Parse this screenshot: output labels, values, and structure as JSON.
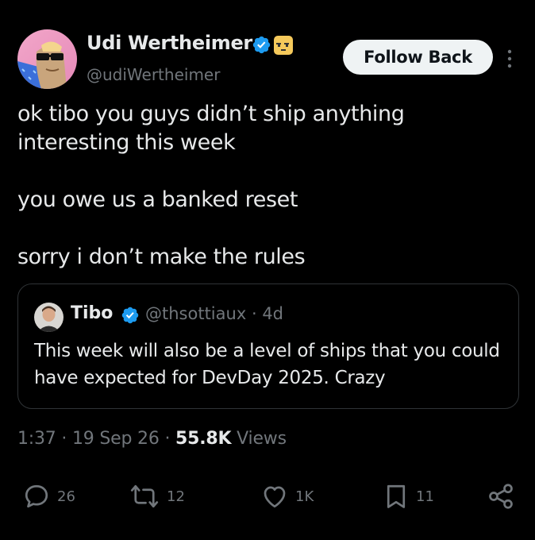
{
  "tweet": {
    "author": {
      "name": "Udi Wertheimer",
      "handle": "@udiWertheimer",
      "avatar_icon": "avatar-sunglasses-icon",
      "verified_icon": "verified-badge-icon",
      "affiliate_icon": "affiliate-badge-icon"
    },
    "follow_label": "Follow Back",
    "more_icon": "more-vertical-icon",
    "text": [
      "ok tibo you guys didn’t ship anything\ninteresting this week",
      "you owe us a banked reset",
      "sorry i don’t make the rules"
    ],
    "quote": {
      "name": "Tibo",
      "handle": "@thsottiaux",
      "sep": "·",
      "age": "4d",
      "text": "This week will also be a level of ships that you could have expected for DevDay 2025. Crazy"
    },
    "timestamp": {
      "time": "1:37",
      "date": "19 Sep 26",
      "views_count": "55.8K",
      "views_label": "Views"
    },
    "actions": {
      "replies": "26",
      "reposts": "12",
      "likes": "1K",
      "bookmarks": "11"
    },
    "colors": {
      "background": "#000000",
      "text": "#e7e9ea",
      "muted": "#71767b",
      "verified": "#1d9bf0",
      "follow_bg": "#eff3f4",
      "border": "#2f3336"
    }
  }
}
